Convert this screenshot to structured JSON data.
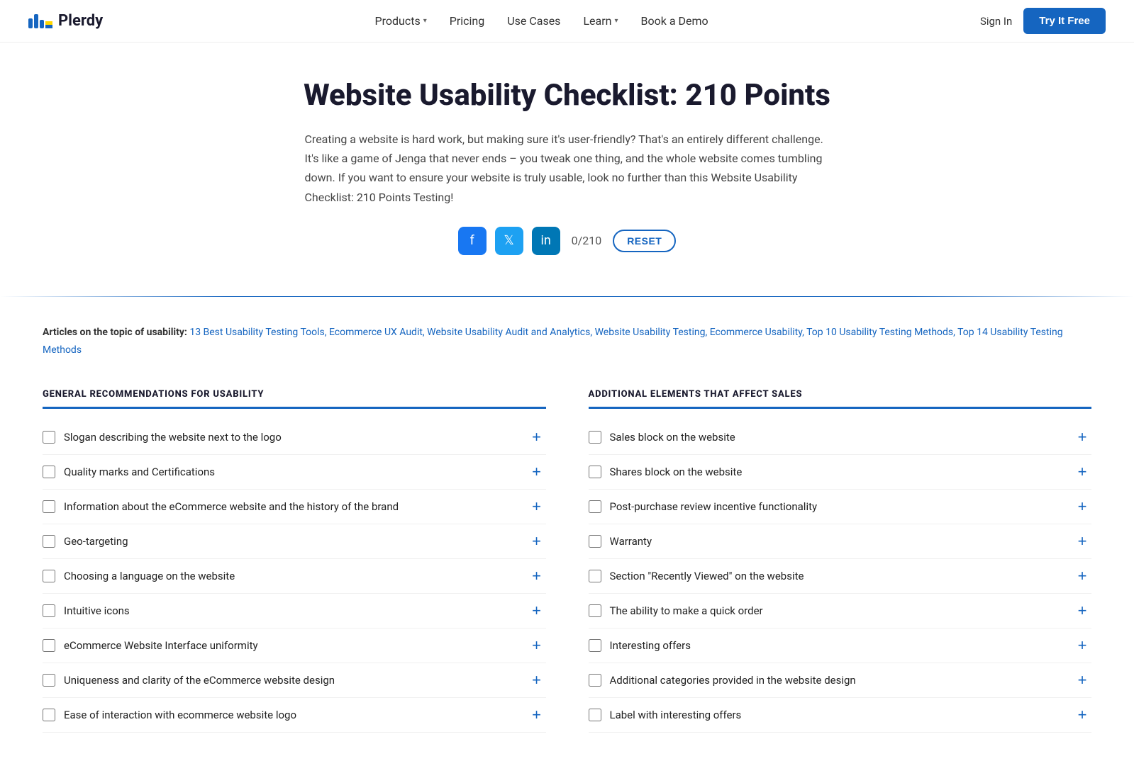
{
  "nav": {
    "logo_text": "Plerdy",
    "links": [
      {
        "label": "Products",
        "has_dropdown": true
      },
      {
        "label": "Pricing",
        "has_dropdown": false
      },
      {
        "label": "Use Cases",
        "has_dropdown": false
      },
      {
        "label": "Learn",
        "has_dropdown": true
      },
      {
        "label": "Book a Demo",
        "has_dropdown": false
      }
    ],
    "sign_in": "Sign In",
    "try_btn": "Try It Free"
  },
  "hero": {
    "title": "Website Usability Checklist: 210 Points",
    "description": "Creating a website is hard work, but making sure it's user-friendly? That's an entirely different challenge. It's like a game of Jenga that never ends – you tweak one thing, and the whole website comes tumbling down. If you want to ensure your website is truly usable, look no further than this Website Usability Checklist: 210 Points Testing!",
    "counter": "0/210",
    "reset_label": "RESET"
  },
  "social": {
    "fb_label": "f",
    "tw_label": "t",
    "li_label": "in"
  },
  "articles": {
    "prefix": "Articles on the topic of usability:",
    "links": [
      "13 Best Usability Testing Tools",
      "Ecommerce UX Audit",
      "Website Usability Audit and Analytics",
      "Website Usability Testing",
      "Ecommerce Usability",
      "Top 10 Usability Testing Methods",
      "Top 14 Usability Testing Methods"
    ]
  },
  "left_col": {
    "title": "GENERAL RECOMMENDATIONS FOR USABILITY",
    "items": [
      "Slogan describing the website next to the logo",
      "Quality marks and Certifications",
      "Information about the eCommerce website and the history of the brand",
      "Geo-targeting",
      "Choosing a language on the website",
      "Intuitive icons",
      "eCommerce Website Interface uniformity",
      "Uniqueness and clarity of the eCommerce website design",
      "Ease of interaction with ecommerce website logo"
    ]
  },
  "right_col": {
    "title": "ADDITIONAL ELEMENTS THAT AFFECT SALES",
    "items": [
      "Sales block on the website",
      "Shares block on the website",
      "Post-purchase review incentive functionality",
      "Warranty",
      "Section “Recently Viewed” on the website",
      "The ability to make a quick order",
      "Interesting offers",
      "Additional categories provided in the website design",
      "Label with interesting offers"
    ]
  }
}
